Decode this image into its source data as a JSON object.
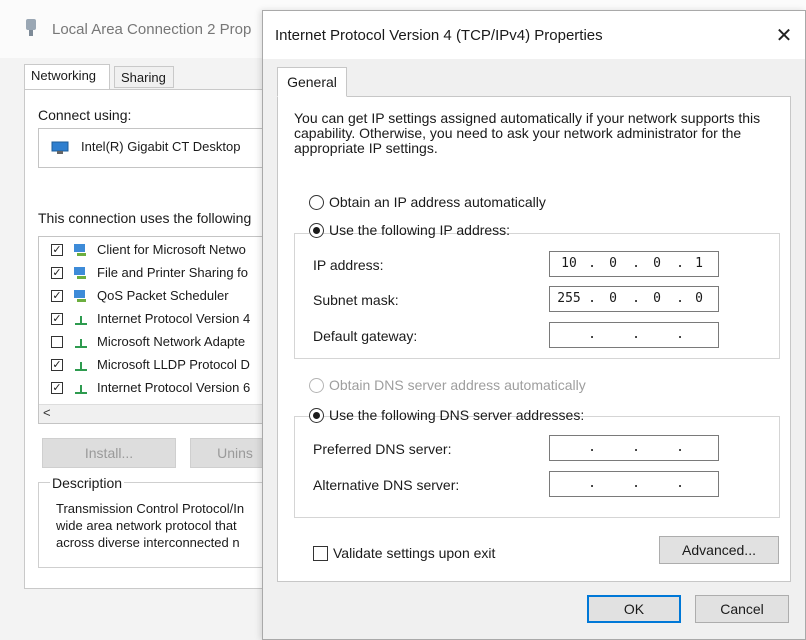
{
  "background_window": {
    "title": "Local Area Connection 2 Prop",
    "tabs": [
      "Networking",
      "Sharing"
    ],
    "connect_using_label": "Connect using:",
    "adapter_name": "Intel(R) Gigabit CT Desktop",
    "uses_label": "This connection uses the following",
    "items": [
      {
        "label": "Client for Microsoft Netwo",
        "checked": true,
        "icon": "network-client-icon"
      },
      {
        "label": "File and Printer Sharing fo",
        "checked": true,
        "icon": "network-service-icon"
      },
      {
        "label": "QoS Packet Scheduler",
        "checked": true,
        "icon": "network-service-icon"
      },
      {
        "label": "Internet Protocol Version 4",
        "checked": true,
        "icon": "protocol-icon"
      },
      {
        "label": "Microsoft Network Adapte",
        "checked": false,
        "icon": "protocol-icon"
      },
      {
        "label": "Microsoft LLDP Protocol D",
        "checked": true,
        "icon": "protocol-icon"
      },
      {
        "label": "Internet Protocol Version 6",
        "checked": true,
        "icon": "protocol-icon"
      }
    ],
    "scroll_left_glyph": "<",
    "install_label": "Install...",
    "uninstall_label": "Unins",
    "description_label": "Description",
    "description_lines": [
      "Transmission Control Protocol/In",
      "wide area network protocol that",
      "across diverse interconnected n"
    ]
  },
  "dialog": {
    "title": "Internet Protocol Version 4 (TCP/IPv4) Properties",
    "close_glyph": "✕",
    "tab_general": "General",
    "intro_text": "You can get IP settings assigned automatically if your network supports this capability. Otherwise, you need to ask your network administrator for the appropriate IP settings.",
    "ip_auto_label": "Obtain an IP address automatically",
    "ip_auto_selected": false,
    "ip_manual_label": "Use the following IP address:",
    "ip_manual_selected": true,
    "ip_address_label": "IP address:",
    "ip_address": [
      "10",
      "0",
      "0",
      "1"
    ],
    "subnet_label": "Subnet mask:",
    "subnet": [
      "255",
      "0",
      "0",
      "0"
    ],
    "gateway_label": "Default gateway:",
    "gateway": [
      "",
      "",
      "",
      ""
    ],
    "dns_auto_label": "Obtain DNS server address automatically",
    "dns_auto_selected": false,
    "dns_auto_disabled": true,
    "dns_manual_label": "Use the following DNS server addresses:",
    "dns_manual_selected": true,
    "preferred_dns_label": "Preferred DNS server:",
    "preferred_dns": [
      "",
      "",
      "",
      ""
    ],
    "alternate_dns_label": "Alternative DNS server:",
    "alternate_dns": [
      "",
      "",
      "",
      ""
    ],
    "validate_label": "Validate settings upon exit",
    "validate_checked": false,
    "advanced_label": "Advanced...",
    "ok_label": "OK",
    "cancel_label": "Cancel"
  }
}
